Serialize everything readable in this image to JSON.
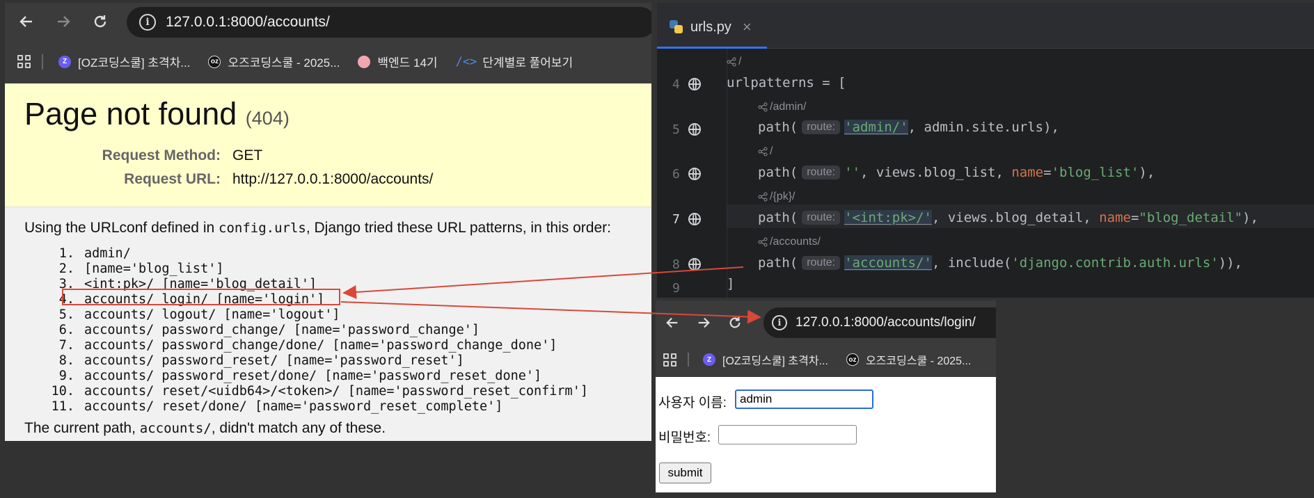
{
  "left_browser": {
    "url": "127.0.0.1:8000/accounts/",
    "bookmarks": [
      {
        "label": "[OZ코딩스쿨] 초격차...",
        "icon": "oz-purple-icon"
      },
      {
        "label": "오즈코딩스쿨 - 2025...",
        "icon": "oz-black-icon"
      },
      {
        "label": "백엔드 14기",
        "icon": "pig-icon"
      },
      {
        "label": "단계별로 풀어보기",
        "icon": "code-icon"
      }
    ],
    "error": {
      "title": "Page not found",
      "code": "(404)",
      "method_label": "Request Method:",
      "method_value": "GET",
      "url_label": "Request URL:",
      "url_value": "http://127.0.0.1:8000/accounts/",
      "intro_pre": "Using the URLconf defined in ",
      "intro_mono": "config.urls",
      "intro_post": ", Django tried these URL patterns, in this order:",
      "patterns": [
        {
          "n": "1.",
          "text": "admin/"
        },
        {
          "n": "2.",
          "text": "[name='blog_list']"
        },
        {
          "n": "3.",
          "text": "<int:pk>/ [name='blog_detail']"
        },
        {
          "n": "4.",
          "text": "accounts/ login/ [name='login']"
        },
        {
          "n": "5.",
          "text": "accounts/ logout/ [name='logout']"
        },
        {
          "n": "6.",
          "text": "accounts/ password_change/ [name='password_change']"
        },
        {
          "n": "7.",
          "text": "accounts/ password_change/done/ [name='password_change_done']"
        },
        {
          "n": "8.",
          "text": "accounts/ password_reset/ [name='password_reset']"
        },
        {
          "n": "9.",
          "text": "accounts/ password_reset/done/ [name='password_reset_done']"
        },
        {
          "n": "10.",
          "text": "accounts/ reset/<uidb64>/<token>/ [name='password_reset_confirm']"
        },
        {
          "n": "11.",
          "text": "accounts/ reset/done/ [name='password_reset_complete']"
        }
      ],
      "outro_pre": "The current path, ",
      "outro_mono": "accounts/",
      "outro_post": ", didn't match any of these."
    }
  },
  "editor": {
    "tab_label": "urls.py",
    "close_glyph": "×",
    "hints": [
      "/",
      "/admin/",
      "/",
      "/{pk}/",
      "/accounts/"
    ],
    "line_numbers": [
      "4",
      "5",
      "6",
      "7",
      "8",
      "9"
    ],
    "route_label": "route:",
    "code": {
      "l4": "urlpatterns = [",
      "l5_a": "path(",
      "l5_b": "'admin/'",
      "l5_c": ", admin.site.urls),",
      "l6_a": "path(",
      "l6_b": "''",
      "l6_c": ", views.blog_list, ",
      "l6_d": "name",
      "l6_e": "=",
      "l6_f": "'blog_list'",
      "l6_g": "),",
      "l7_a": "path(",
      "l7_b": "'<int:pk>/'",
      "l7_c": ", views.blog_detail, ",
      "l7_d": "name",
      "l7_e": "=",
      "l7_f": "\"blog_detail\"",
      "l7_g": "),",
      "l8_a": "path(",
      "l8_b": "'accounts/'",
      "l8_c": ", include(",
      "l8_d": "'django.contrib.auth.urls'",
      "l8_e": ")),",
      "l9": "]"
    }
  },
  "login_browser": {
    "url": "127.0.0.1:8000/accounts/login/",
    "bookmarks": [
      {
        "label": "[OZ코딩스쿨] 초격차...",
        "icon": "oz-purple-icon"
      },
      {
        "label": "오즈코딩스쿨 - 2025...",
        "icon": "oz-black-icon"
      }
    ],
    "form": {
      "username_label": "사용자 이름:",
      "username_value": "admin",
      "password_label": "비밀번호:",
      "password_value": "",
      "submit_label": "submit"
    }
  },
  "colors": {
    "annotation_red": "#d9483b",
    "error_yellow": "#ffffcc",
    "string_green": "#6aab73",
    "named_arg_orange": "#d5744c"
  }
}
